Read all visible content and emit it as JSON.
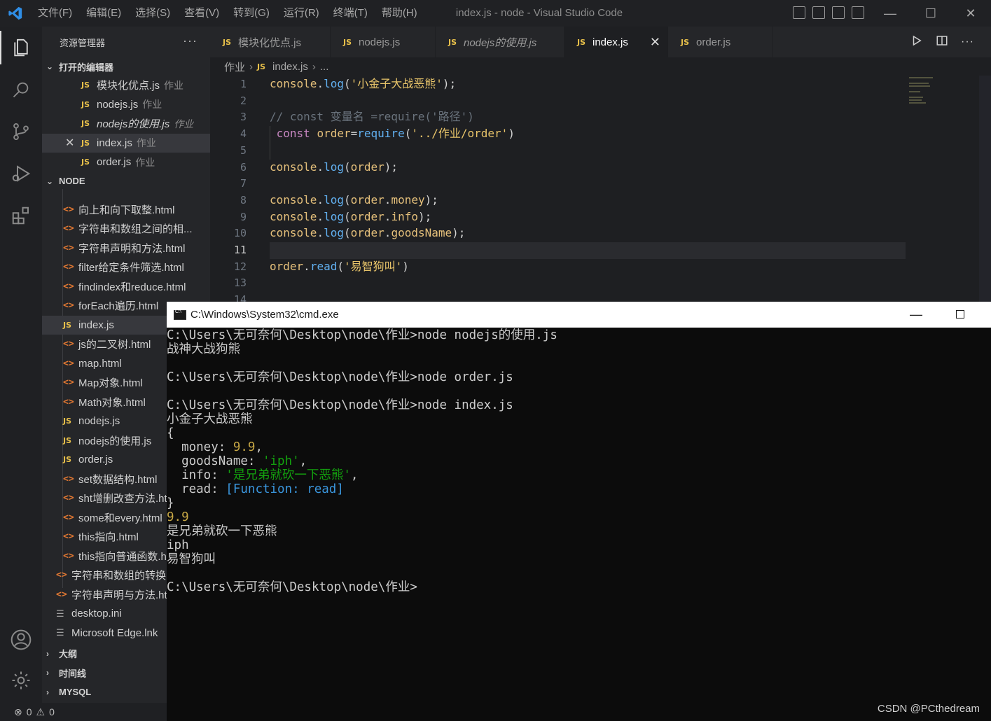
{
  "titlebar": {
    "menu": [
      "文件(F)",
      "编辑(E)",
      "选择(S)",
      "查看(V)",
      "转到(G)",
      "运行(R)",
      "终端(T)",
      "帮助(H)"
    ],
    "window_title": "index.js - node - Visual Studio Code",
    "minimize": "—",
    "maximize": "☐",
    "close": "✕"
  },
  "activity": [
    "explorer-icon",
    "search-icon",
    "source-control-icon",
    "run-debug-icon",
    "extensions-icon",
    "accounts-icon",
    "settings-gear-icon"
  ],
  "sidebar": {
    "title": "资源管理器",
    "more": "···",
    "open_editors_label": "打开的编辑器",
    "open_editors": [
      {
        "badge": "JS",
        "name": "模块化优点.js",
        "dir": "作业",
        "italic": false,
        "selected": false
      },
      {
        "badge": "JS",
        "name": "nodejs.js",
        "dir": "作业",
        "italic": false,
        "selected": false
      },
      {
        "badge": "JS",
        "name": "nodejs的使用.js",
        "dir": "作业",
        "italic": true,
        "selected": false
      },
      {
        "badge": "JS",
        "name": "index.js",
        "dir": "作业",
        "italic": false,
        "selected": true,
        "close": "✕"
      },
      {
        "badge": "JS",
        "name": "order.js",
        "dir": "作业",
        "italic": false,
        "selected": false
      }
    ],
    "folder_label": "NODE",
    "files": [
      {
        "type": "html",
        "name": "向上和向下取整.html"
      },
      {
        "type": "html",
        "name": "字符串和数组之间的相..."
      },
      {
        "type": "html",
        "name": "字符串声明和方法.html"
      },
      {
        "type": "html",
        "name": "filter给定条件筛选.html"
      },
      {
        "type": "html",
        "name": "findindex和reduce.html"
      },
      {
        "type": "html",
        "name": "forEach遍历.html"
      },
      {
        "type": "js",
        "name": "index.js",
        "selected": true
      },
      {
        "type": "html",
        "name": "js的二叉树.html"
      },
      {
        "type": "html",
        "name": "map.html"
      },
      {
        "type": "html",
        "name": "Map对象.html"
      },
      {
        "type": "html",
        "name": "Math对象.html"
      },
      {
        "type": "js",
        "name": "nodejs.js"
      },
      {
        "type": "js",
        "name": "nodejs的使用.js"
      },
      {
        "type": "js",
        "name": "order.js"
      },
      {
        "type": "html",
        "name": "set数据结构.html"
      },
      {
        "type": "html",
        "name": "sht增删改查方法.html"
      },
      {
        "type": "html",
        "name": "some和every.html"
      },
      {
        "type": "html",
        "name": "this指向.html"
      },
      {
        "type": "html",
        "name": "this指向普通函数.html"
      }
    ],
    "root_files": [
      {
        "type": "html",
        "name": "字符串和数组的转换.html"
      },
      {
        "type": "html",
        "name": "字符串声明与方法.html"
      },
      {
        "type": "cfg",
        "name": "desktop.ini"
      },
      {
        "type": "cfg",
        "name": "Microsoft Edge.lnk"
      }
    ],
    "outline_label": "大纲",
    "timeline_label": "时间线",
    "mysql_label": "MYSQL"
  },
  "tabs": [
    {
      "name": "模块化优点.js",
      "italic": false,
      "active": false
    },
    {
      "name": "nodejs.js",
      "italic": false,
      "active": false
    },
    {
      "name": "nodejs的使用.js",
      "italic": true,
      "active": false
    },
    {
      "name": "index.js",
      "italic": false,
      "active": true
    },
    {
      "name": "order.js",
      "italic": false,
      "active": false
    }
  ],
  "tab_badge": "JS",
  "tab_close": "✕",
  "breadcrumb": [
    "作业",
    "index.js",
    "..."
  ],
  "editor": {
    "line_numbers": [
      "1",
      "2",
      "3",
      "4",
      "5",
      "6",
      "7",
      "8",
      "9",
      "10",
      "11",
      "12",
      "13",
      "14"
    ],
    "current_line": "11",
    "lines": [
      "console.log('小金子大战恶熊');",
      "",
      "// const 变量名 =require('路径')",
      " const order=require('../作业/order')",
      "",
      "console.log(order);",
      "",
      "console.log(order.money);",
      "console.log(order.info);",
      "console.log(order.goodsName);",
      "",
      "order.read('易智狗叫')",
      "",
      ""
    ]
  },
  "cmd": {
    "title": "C:\\Windows\\System32\\cmd.exe",
    "min": "—",
    "lines": [
      "C:\\Users\\无可奈何\\Desktop\\node\\作业>node nodejs的使用.js",
      "战神大战狗熊",
      "",
      "C:\\Users\\无可奈何\\Desktop\\node\\作业>node order.js",
      "",
      "C:\\Users\\无可奈何\\Desktop\\node\\作业>node index.js",
      "小金子大战恶熊",
      "{",
      "  money: 9.9,",
      "  goodsName: 'iph',",
      "  info: '是兄弟就砍一下恶熊',",
      "  read: [Function: read]",
      "}",
      "9.9",
      "是兄弟就砍一下恶熊",
      "iph",
      "易智狗叫",
      "",
      "C:\\Users\\无可奈何\\Desktop\\node\\作业>"
    ]
  },
  "status": {
    "errors": "0",
    "warnings": "0"
  },
  "watermark": "CSDN @PCthedream",
  "colors": {
    "accent": "#3794ff",
    "js_badge": "#e8c04a",
    "html_badge": "#e37933",
    "cmd_bg": "#0c0c0c"
  }
}
